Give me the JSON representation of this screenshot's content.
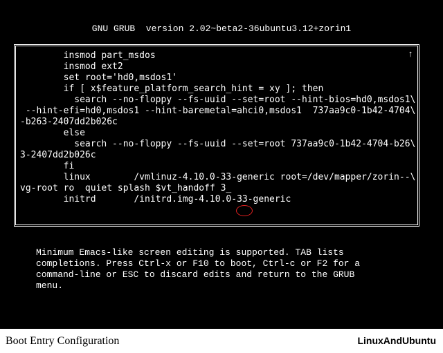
{
  "title": "GNU GRUB  version 2.02~beta2-36ubuntu3.12+zorin1",
  "lines": [
    "        insmod part_msdos",
    "        insmod ext2",
    "        set root='hd0,msdos1'",
    "        if [ x$feature_platform_search_hint = xy ]; then",
    "          search --no-floppy --fs-uuid --set=root --hint-bios=hd0,msdos1\\",
    " --hint-efi=hd0,msdos1 --hint-baremetal=ahci0,msdos1  737aa9c0-1b42-4704\\",
    "-b263-2407dd2b026c",
    "        else",
    "          search --no-floppy --fs-uuid --set=root 737aa9c0-1b42-4704-b26\\",
    "3-2407dd2b026c",
    "        fi",
    "        linux        /vmlinuz-4.10.0-33-generic root=/dev/mapper/zorin--\\",
    "vg-root ro  quiet splash $vt_handoff 3_",
    "        initrd       /initrd.img-4.10.0-33-generic",
    ""
  ],
  "help": "Minimum Emacs-like screen editing is supported. TAB lists\ncompletions. Press Ctrl-x or F10 to boot, Ctrl-c or F2 for a\ncommand-line or ESC to discard edits and return to the GRUB\nmenu.",
  "footer": {
    "left": "Boot Entry Configuration",
    "right": "LinuxAndUbuntu"
  }
}
